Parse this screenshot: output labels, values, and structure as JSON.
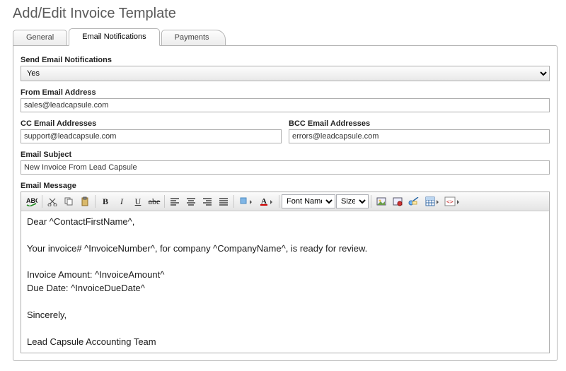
{
  "page_title": "Add/Edit Invoice Template",
  "tabs": {
    "general": "General",
    "email_notifications": "Email Notifications",
    "payments": "Payments",
    "active": "email_notifications"
  },
  "labels": {
    "send_email": "Send Email Notifications",
    "from_email": "From Email Address",
    "cc_email": "CC Email Addresses",
    "bcc_email": "BCC Email Addresses",
    "subject": "Email Subject",
    "message": "Email Message"
  },
  "values": {
    "send_email": "Yes",
    "from_email": "sales@leadcapsule.com",
    "cc_email": "support@leadcapsule.com",
    "bcc_email": "errors@leadcapsule.com",
    "subject": "New Invoice From Lead Capsule",
    "message_lines": [
      "Dear ^ContactFirstName^,",
      "",
      "Your invoice# ^InvoiceNumber^, for company ^CompanyName^, is ready for review.",
      "",
      "Invoice Amount: ^InvoiceAmount^",
      "Due Date: ^InvoiceDueDate^",
      "",
      "Sincerely,",
      "",
      "Lead Capsule Accounting Team"
    ]
  },
  "toolbar": {
    "font_name_label": "Font Name",
    "size_label": "Size"
  }
}
